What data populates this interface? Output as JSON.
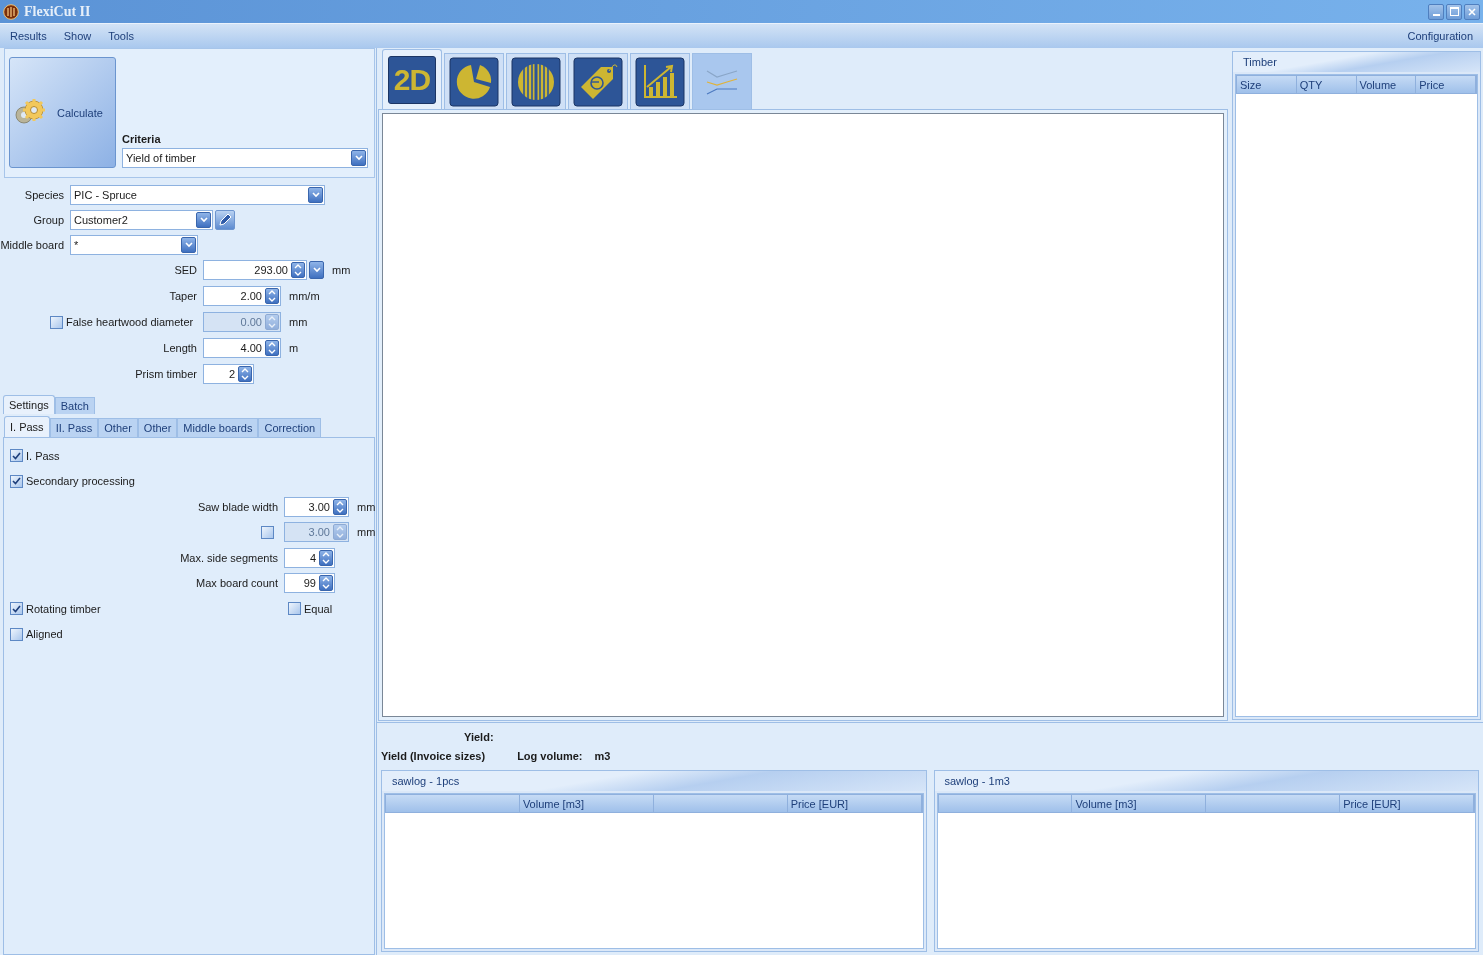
{
  "window": {
    "title": "FlexiCut II"
  },
  "menu": {
    "items": [
      "Results",
      "Show",
      "Tools"
    ],
    "right_item": "Configuration"
  },
  "calculate_button": {
    "label": "Calculate"
  },
  "criteria": {
    "label": "Criteria",
    "value": "Yield of timber"
  },
  "log_fields": [
    {
      "kind": "combo",
      "label": "Species",
      "value": "PIC - Spruce"
    },
    {
      "kind": "combo-edit",
      "label": "Group",
      "value": "Customer2"
    },
    {
      "kind": "combo",
      "label": "Middle board",
      "value": "*"
    },
    {
      "kind": "spin-combo",
      "label": "SED",
      "value": "293.00",
      "unit": "mm"
    },
    {
      "kind": "spin",
      "label": "Taper",
      "value": "2.00",
      "unit": "mm/m"
    },
    {
      "kind": "check-spin",
      "label": "False heartwood diameter",
      "checked": false,
      "value": "0.00",
      "unit": "mm"
    },
    {
      "kind": "spin",
      "label": "Length",
      "value": "4.00",
      "unit": "m"
    },
    {
      "kind": "spin",
      "label": "Prism timber",
      "value": "2"
    }
  ],
  "settings_tabs": [
    {
      "label": "Settings",
      "selected": true
    },
    {
      "label": "Batch",
      "selected": false
    }
  ],
  "pass_tabs": [
    {
      "label": "I. Pass",
      "selected": true
    },
    {
      "label": "II. Pass",
      "selected": false
    },
    {
      "label": "Other",
      "selected": false
    },
    {
      "label": "Other",
      "selected": false
    },
    {
      "label": "Middle boards",
      "selected": false
    },
    {
      "label": "Correction",
      "selected": false
    }
  ],
  "pass_settings": [
    {
      "kind": "check",
      "label": "I. Pass",
      "checked": true
    },
    {
      "kind": "check",
      "label": "Secondary processing",
      "checked": true
    },
    {
      "kind": "spin",
      "label": "Saw blade width",
      "value": "3.00",
      "unit": "mm"
    },
    {
      "kind": "check-spin",
      "checked": false,
      "value": "3.00",
      "unit": "mm"
    },
    {
      "kind": "spin",
      "label": "Max. side segments",
      "value": "4"
    },
    {
      "kind": "spin",
      "label": "Max board count",
      "value": "99"
    },
    {
      "kind": "check-pair",
      "label": "Rotating timber",
      "checked": true,
      "second_label": "Equal",
      "second_checked": false
    },
    {
      "kind": "check",
      "label": "Aligned",
      "checked": false
    }
  ],
  "view_tabs": [
    {
      "kind": "text",
      "label": "2D",
      "selected": true,
      "disabled": false
    },
    {
      "kind": "pie",
      "selected": false,
      "disabled": false
    },
    {
      "kind": "log-section",
      "selected": false,
      "disabled": false
    },
    {
      "kind": "price-tag",
      "selected": false,
      "disabled": false
    },
    {
      "kind": "bar-chart",
      "selected": false,
      "disabled": false
    },
    {
      "kind": "lines",
      "selected": false,
      "disabled": true
    }
  ],
  "timber_table": {
    "title": "Timber",
    "columns": [
      "Size",
      "QTY",
      "Volume",
      "Price"
    ]
  },
  "summary": {
    "yield_label": "Yield:",
    "invoice_label": "Yield (Invoice sizes)",
    "log_volume_label": "Log volume:",
    "log_volume_unit": "m3"
  },
  "result_tables": [
    {
      "title": "sawlog - 1pcs",
      "columns": [
        "Volume [m3]",
        "Price [EUR]"
      ]
    },
    {
      "title": "sawlog - 1m3",
      "columns": [
        "Volume [m3]",
        "Price [EUR]"
      ]
    }
  ]
}
